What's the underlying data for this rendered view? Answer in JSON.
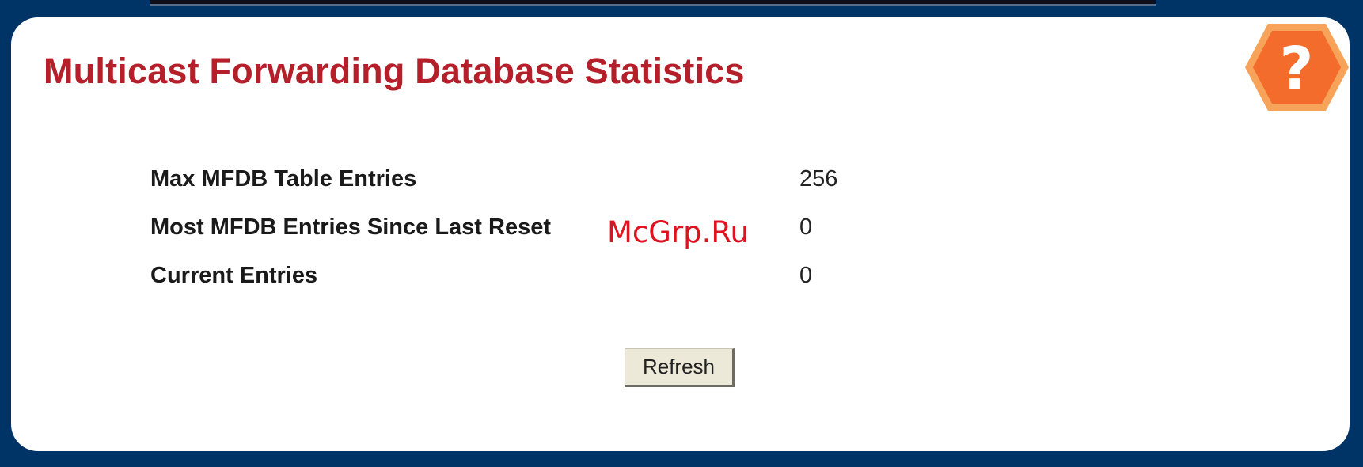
{
  "page": {
    "title": "Multicast Forwarding Database Statistics"
  },
  "help": {
    "icon": "help-question-icon",
    "glyph": "?",
    "color": "#f36c2c"
  },
  "stats": [
    {
      "label": "Max MFDB Table Entries",
      "value": "256"
    },
    {
      "label": "Most MFDB Entries Since Last Reset",
      "value": "0"
    },
    {
      "label": "Current Entries",
      "value": "0"
    }
  ],
  "actions": {
    "refresh_label": "Refresh"
  },
  "watermark": {
    "text": "McGrp.Ru"
  },
  "colors": {
    "frame": "#003366",
    "title": "#b51f2a",
    "watermark": "#e0121f"
  }
}
